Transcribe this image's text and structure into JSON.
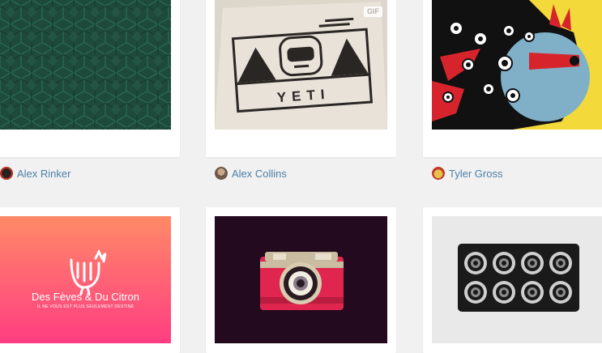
{
  "shots": [
    {
      "author": "Alex Rinker",
      "avatar_icon": "red-emblem-avatar",
      "badge": ""
    },
    {
      "author": "Alex Collins",
      "avatar_icon": "photo-avatar",
      "badge": "GIF",
      "art_text": "YETI"
    },
    {
      "author": "Tyler Gross",
      "avatar_icon": "illustrated-avatar",
      "badge": ""
    },
    {
      "author": "",
      "art_title": "Des Fèves & Du Citron",
      "art_subtitle": "IL NE VOUS EST PLUS SEULEMENT DESTINÉ"
    },
    {
      "author": "",
      "art_text": ""
    },
    {
      "author": "",
      "art_text": ""
    }
  ],
  "colors": {
    "background": "#f1f1f1",
    "card": "#ffffff",
    "author_link": "#4a7fa8",
    "pattern_green": "#1e4a3c",
    "pink_gradient_start": "#ff8a67",
    "pink_gradient_end": "#ff3d82",
    "camera_bg": "#230a1f",
    "camera_red": "#e0254f"
  }
}
